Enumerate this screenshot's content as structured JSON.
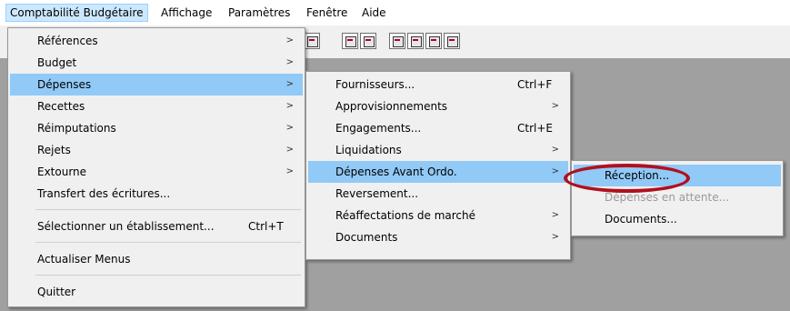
{
  "menubar": {
    "items": [
      "Comptabilité Budgétaire",
      "Affichage",
      "Paramètres",
      "Fenêtre",
      "Aide"
    ]
  },
  "main_menu": {
    "items": [
      {
        "label": "Références"
      },
      {
        "label": "Budget"
      },
      {
        "label": "Dépenses"
      },
      {
        "label": "Recettes"
      },
      {
        "label": "Réimputations"
      },
      {
        "label": "Rejets"
      },
      {
        "label": "Extourne"
      },
      {
        "label": "Transfert des écritures..."
      },
      {
        "label": "Sélectionner un établissement...",
        "shortcut": "Ctrl+T"
      },
      {
        "label": "Actualiser Menus"
      },
      {
        "label": "Quitter"
      }
    ]
  },
  "depenses_menu": {
    "items": [
      {
        "label": "Fournisseurs...",
        "shortcut": "Ctrl+F"
      },
      {
        "label": "Approvisionnements"
      },
      {
        "label": "Engagements...",
        "shortcut": "Ctrl+E"
      },
      {
        "label": "Liquidations"
      },
      {
        "label": "Dépenses Avant Ordo."
      },
      {
        "label": "Reversement..."
      },
      {
        "label": "Réaffectations de marché"
      },
      {
        "label": "Documents"
      }
    ]
  },
  "avant_ordo_menu": {
    "items": [
      {
        "label": "Réception..."
      },
      {
        "label": "Dépenses en attente..."
      },
      {
        "label": "Documents..."
      }
    ]
  },
  "arrow_glyph": ">",
  "colors": {
    "highlight": "#91c9f7",
    "menubar_active": "#cce8ff",
    "ellipse": "#b0101f"
  }
}
